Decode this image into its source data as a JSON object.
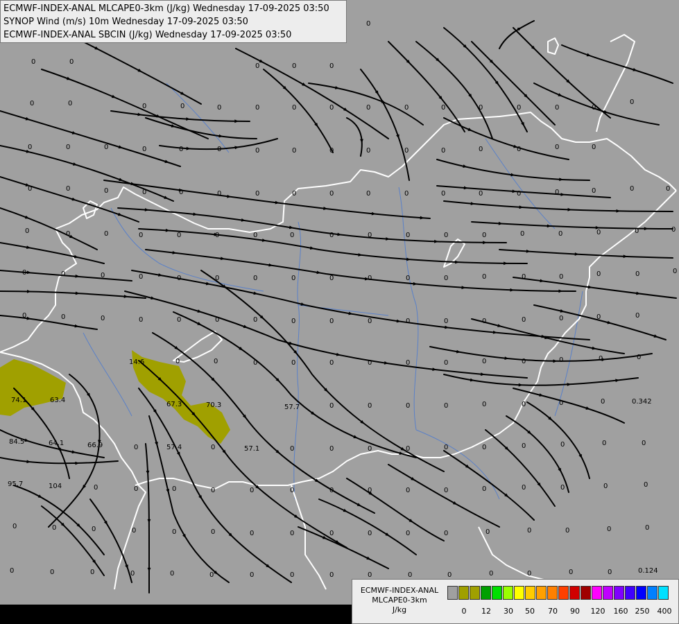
{
  "header": {
    "line1": "ECMWF-INDEX-ANAL MLCAPE0-3km (J/kg) Wednesday 17-09-2025 03:50",
    "line2": "SYNOP Wind (m/s) 10m Wednesday 17-09-2025 03:50",
    "line3": "ECMWF-INDEX-ANAL SBCIN (J/kg) Wednesday 17-09-2025 03:50"
  },
  "legend": {
    "title1": "ECMWF-INDEX-ANAL",
    "title2": "MLCAPE0-3km",
    "units": "J/kg",
    "colors": [
      "#a0a0a0",
      "#a0a000",
      "#a0a000",
      "#00a000",
      "#00e000",
      "#9aff00",
      "#ffff00",
      "#ffcc00",
      "#ffa000",
      "#ff8000",
      "#ff4000",
      "#d00000",
      "#a00000",
      "#ff00ff",
      "#c000ff",
      "#8000ff",
      "#4000ff",
      "#0000ff",
      "#0080ff",
      "#00e0ff",
      "#80ffff",
      "#ffffff"
    ],
    "ticks": [
      "0",
      "12",
      "30",
      "50",
      "70",
      "90",
      "120",
      "160",
      "250",
      "400"
    ]
  },
  "map": {
    "background": "#a0a0a0",
    "cape_fill": "#a0a000",
    "labels": [
      {
        "t": "0"
      },
      {
        "t": "0"
      },
      {
        "t": "0"
      },
      {
        "t": "0"
      },
      {
        "t": "0"
      },
      {
        "t": "0"
      },
      {
        "t": "0"
      },
      {
        "t": "0"
      },
      {
        "t": "0"
      },
      {
        "t": "0"
      },
      {
        "t": "14.6"
      },
      {
        "t": "74.1"
      },
      {
        "t": "63.4"
      },
      {
        "t": "67.3"
      },
      {
        "t": "70.3"
      },
      {
        "t": "57.7"
      },
      {
        "t": "84.5"
      },
      {
        "t": "64.1"
      },
      {
        "t": "66.9"
      },
      {
        "t": "57.4"
      },
      {
        "t": "57.1"
      },
      {
        "t": "95.7"
      },
      {
        "t": "104"
      },
      {
        "t": "0.342"
      },
      {
        "t": "0.124"
      }
    ]
  }
}
